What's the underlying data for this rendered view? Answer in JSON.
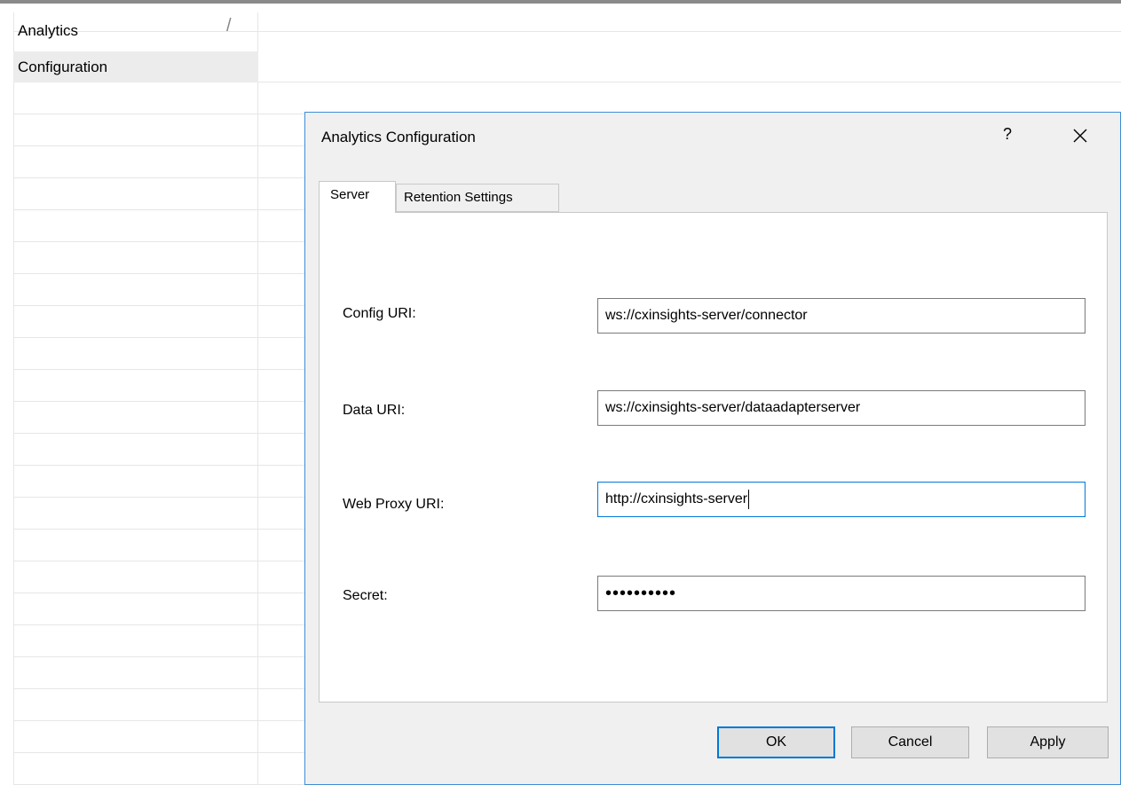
{
  "background": {
    "rows": [
      {
        "label": "Analytics",
        "marker": "/"
      },
      {
        "label": "Configuration"
      }
    ]
  },
  "dialog": {
    "title": "Analytics Configuration",
    "help_label": "?",
    "close_icon": "close-icon",
    "tabs": [
      {
        "label": "Server",
        "selected": true
      },
      {
        "label": "Retention Settings",
        "selected": false
      }
    ],
    "fields": [
      {
        "label": "Config URI:",
        "value": "ws://cxinsights-server/connector"
      },
      {
        "label": "Data URI:",
        "value": "ws://cxinsights-server/dataadapterserver"
      },
      {
        "label": "Web Proxy URI:",
        "value": "http://cxinsights-server"
      },
      {
        "label": "Secret:",
        "value": "••••••••••"
      }
    ],
    "buttons": {
      "ok": "OK",
      "cancel": "Cancel",
      "apply": "Apply"
    }
  },
  "colors": {
    "accent": "#0078d7",
    "dialog_border": "#3d8fd6",
    "dialog_bg": "#f0f0f0"
  }
}
